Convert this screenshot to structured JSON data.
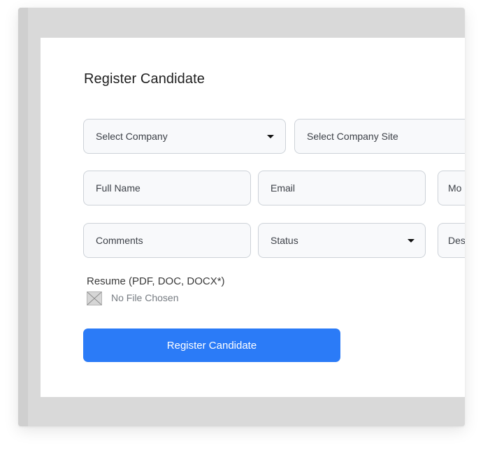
{
  "form": {
    "title": "Register Candidate",
    "company_placeholder": "Select Company",
    "site_placeholder": "Select Company Site",
    "full_name_placeholder": "Full Name",
    "email_placeholder": "Email",
    "mobile_placeholder": "Mo",
    "comments_placeholder": "Comments",
    "status_placeholder": "Status",
    "designation_placeholder": "Des",
    "resume_label": "Resume (PDF, DOC, DOCX*)",
    "file_status": "No File Chosen",
    "submit_label": "Register Candidate"
  },
  "colors": {
    "accent": "#2b7bf7",
    "field_bg": "#f8f9fb",
    "field_border": "#cdd2d8",
    "backdrop": "#d9d9d9"
  },
  "icons": {
    "dropdown": "caret-down-icon",
    "file": "file-placeholder-icon"
  }
}
